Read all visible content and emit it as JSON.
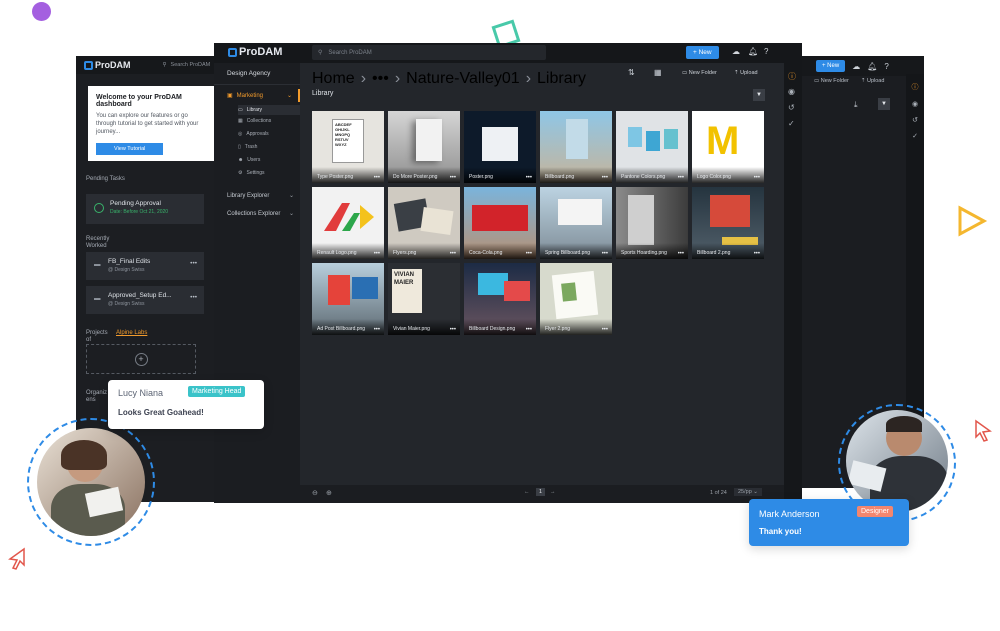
{
  "back_left": {
    "logo": "ProDAM",
    "search_placeholder": "Search ProDAM",
    "welcome_title": "Welcome to your ProDAM dashboard",
    "welcome_body": "You can explore our features or go through tutorial to get started with your journey...",
    "tutorial_button": "View Tutorial",
    "pending_tasks_label": "Pending Tasks",
    "pending_card": {
      "title": "Pending Approval",
      "sub": "Date: Before Oct 21, 2020"
    },
    "recently_worked_label": "Recently Worked",
    "recent_cards": [
      {
        "title": "FB_Final Edits",
        "sub": "@ Design Swiss"
      },
      {
        "title": "Approved_Setup Ed...",
        "sub": "@ Design Swiss"
      }
    ],
    "projects_label": "Projects of",
    "projects_filter": "Alpine Labs",
    "organization_label": "Organiz ens"
  },
  "back_right": {
    "new_button": "+ New",
    "new_folder": "New Folder",
    "upload": "Upload"
  },
  "main": {
    "logo": "ProDAM",
    "search_placeholder": "Search ProDAM",
    "new_button": "+ New",
    "org_name": "Design Agency",
    "nav_main": "Marketing",
    "nav_sub": [
      "Library",
      "Collections",
      "Approvals",
      "Trash",
      "Users",
      "Settings"
    ],
    "library_explorer": "Library Explorer",
    "collections_explorer": "Collections Explorer",
    "breadcrumb": [
      "Home",
      "•••",
      "Nature-Valley01",
      "Library"
    ],
    "new_folder": "New Folder",
    "upload": "Upload",
    "section_title": "Library",
    "tiles": [
      "Type Poster.png",
      "Do More Poster.png",
      "Poster.png",
      "Billboard.png",
      "Pantone Colors.png",
      "Logo Color.png",
      "Renault Logo.png",
      "Flyers.png",
      "Coca-Cola.png",
      "Spring Billboard.png",
      "Sports Hoarding.png",
      "Billboard 2.png",
      "Ad Post Billboard.png",
      "Vivian Maier.png",
      "Billboard Design.png",
      "Flyer 2.png"
    ],
    "pagination_current": "1",
    "page_count": "1 of 24",
    "per_page": "25/pp"
  },
  "chat_left": {
    "name": "Lucy Niana",
    "role": "Marketing Head",
    "message": "Looks Great Goahead!"
  },
  "chat_right": {
    "name": "Mark Anderson",
    "role": "Designer",
    "message": "Thank you!"
  },
  "colors": {
    "accent": "#2e8be6",
    "marketing_orange": "#f29b2c",
    "purple_dot": "#a45fe0",
    "teal_badge": "#3ac3c9",
    "salmon_badge": "#f3866e"
  }
}
